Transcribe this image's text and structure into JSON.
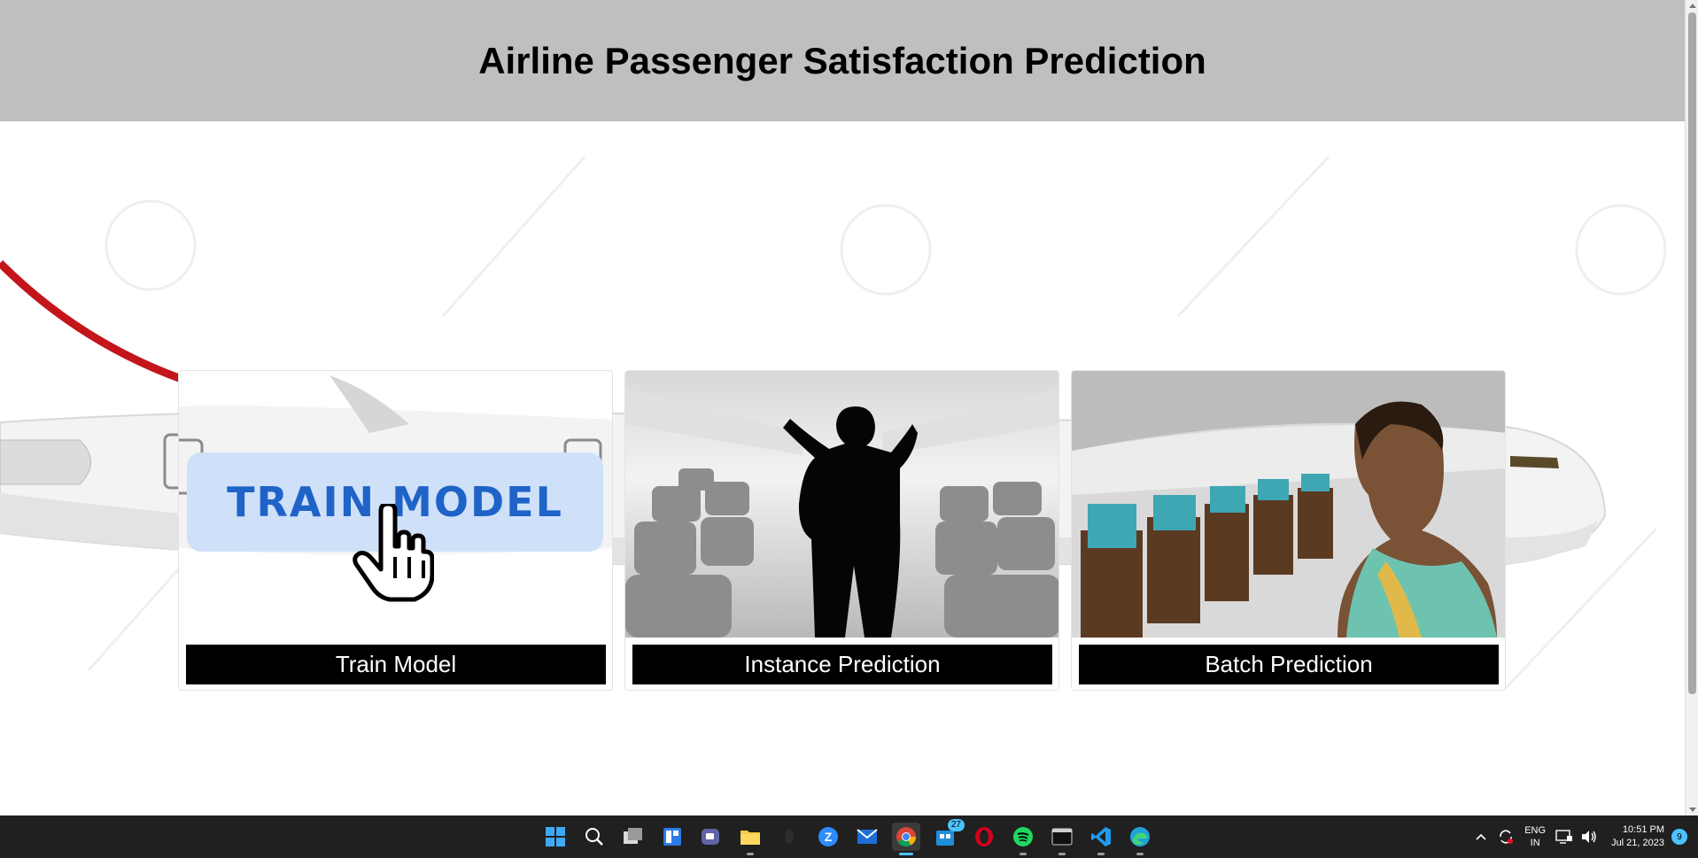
{
  "header": {
    "title": "Airline Passenger Satisfaction Prediction"
  },
  "cards": [
    {
      "label": "Train Model",
      "pill_text": "TRAIN MODEL"
    },
    {
      "label": "Instance Prediction"
    },
    {
      "label": "Batch Prediction"
    }
  ],
  "taskbar": {
    "icons": [
      "windows-start-icon",
      "search-icon",
      "task-view-icon",
      "widgets-icon",
      "teams-chat-icon",
      "file-explorer-icon",
      "cloud-app-icon",
      "zoom-icon",
      "mail-icon",
      "chrome-icon",
      "store-icon",
      "opera-icon",
      "spotify-icon",
      "terminal-icon",
      "vscode-icon",
      "edge-icon"
    ],
    "store_badge": "27",
    "tray": {
      "lang_top": "ENG",
      "lang_bottom": "IN",
      "time": "10:51 PM",
      "date": "Jul 21, 2023",
      "notification_count": "9"
    }
  },
  "colors": {
    "header_bg": "#bfbfbf",
    "caption_bg": "#000000",
    "accent": "#1f63c8"
  }
}
